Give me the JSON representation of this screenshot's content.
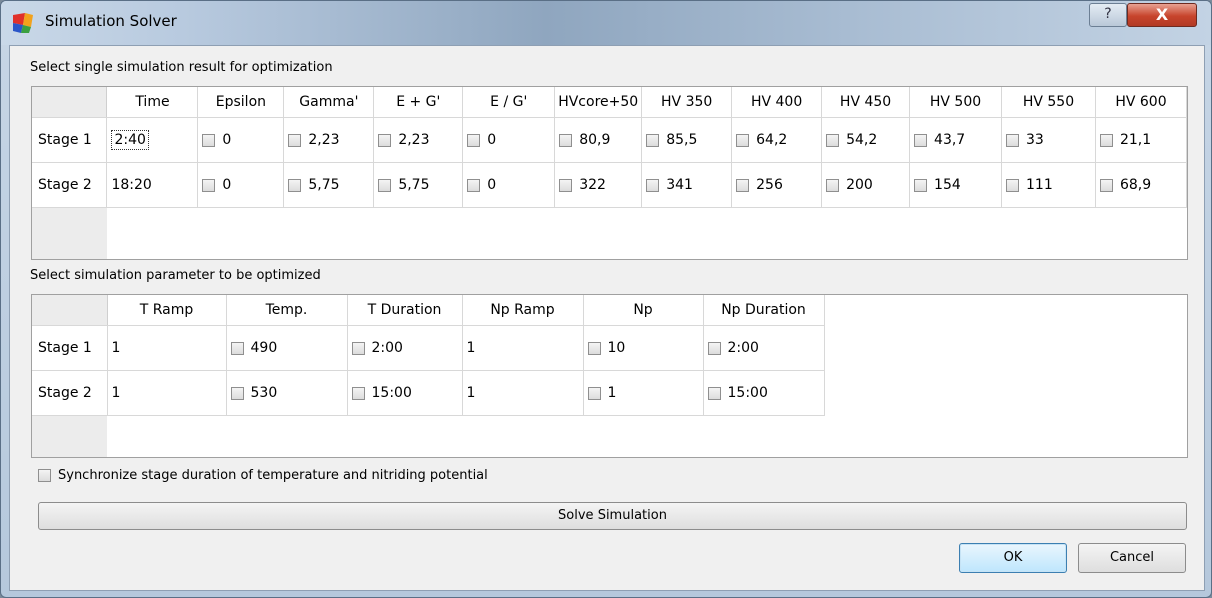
{
  "window": {
    "title": "Simulation Solver",
    "help_glyph": "?",
    "close_glyph": "X"
  },
  "results_section": {
    "label": "Select single simulation result for optimization",
    "columns": [
      "Time",
      "Epsilon",
      "Gamma'",
      "E + G'",
      "E / G'",
      "HVcore+50",
      "HV 350",
      "HV 400",
      "HV 450",
      "HV 500",
      "HV 550",
      "HV 600"
    ],
    "rows": [
      {
        "label": "Stage 1",
        "time": "2:40",
        "values": [
          "0",
          "2,23",
          "2,23",
          "0",
          "80,9",
          "85,5",
          "64,2",
          "54,2",
          "43,7",
          "33",
          "21,1"
        ]
      },
      {
        "label": "Stage 2",
        "time": "18:20",
        "values": [
          "0",
          "5,75",
          "5,75",
          "0",
          "322",
          "341",
          "256",
          "200",
          "154",
          "111",
          "68,9"
        ]
      }
    ]
  },
  "params_section": {
    "label": "Select simulation parameter to be optimized",
    "columns": [
      "T Ramp",
      "Temp.",
      "T Duration",
      "Np Ramp",
      "Np",
      "Np Duration"
    ],
    "rows": [
      {
        "label": "Stage 1",
        "t_ramp": "1",
        "temp": "490",
        "t_duration": "2:00",
        "np_ramp": "1",
        "np": "10",
        "np_duration": "2:00"
      },
      {
        "label": "Stage 2",
        "t_ramp": "1",
        "temp": "530",
        "t_duration": "15:00",
        "np_ramp": "1",
        "np": "1",
        "np_duration": "15:00"
      }
    ]
  },
  "sync_checkbox_label": "Synchronize stage duration of temperature and nitriding potential",
  "buttons": {
    "solve": "Solve Simulation",
    "ok": "OK",
    "cancel": "Cancel"
  }
}
